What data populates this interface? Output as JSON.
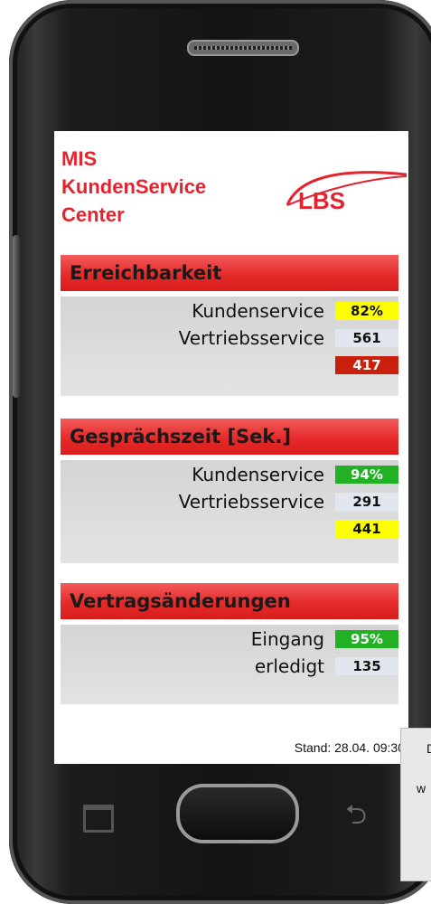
{
  "header": {
    "title": "MIS\nKundenService\nCenter",
    "logo_text": "LBS"
  },
  "sections": [
    {
      "title": "Erreichbarkeit",
      "rows": [
        {
          "label": "Kundenservice",
          "value": "82%",
          "color": "#ffff00"
        },
        {
          "label": "Vertriebsservice",
          "value": "561",
          "color": "#e2e6ef"
        },
        {
          "label": "",
          "value": "417",
          "color": "#c8200d"
        }
      ]
    },
    {
      "title": "Gesprächszeit [Sek.]",
      "rows": [
        {
          "label": "Kundenservice",
          "value": "94%",
          "color": "#22b024"
        },
        {
          "label": "Vertriebsservice",
          "value": "291",
          "color": "#e2e6ef"
        },
        {
          "label": "",
          "value": "441",
          "color": "#ffff00"
        }
      ]
    },
    {
      "title": "Vertragsänderungen",
      "rows": [
        {
          "label": "Eingang",
          "value": "95%",
          "color": "#22b024"
        },
        {
          "label": "erledigt",
          "value": "135",
          "color": "#e2e6ef"
        }
      ]
    }
  ],
  "footer": {
    "stand": "Stand: 28.04. 09:30"
  },
  "tooltip": {
    "line1": "D",
    "line2": "w"
  },
  "icons": {
    "recent": "recent-apps-icon",
    "home": "home-button",
    "back": "back-icon"
  }
}
